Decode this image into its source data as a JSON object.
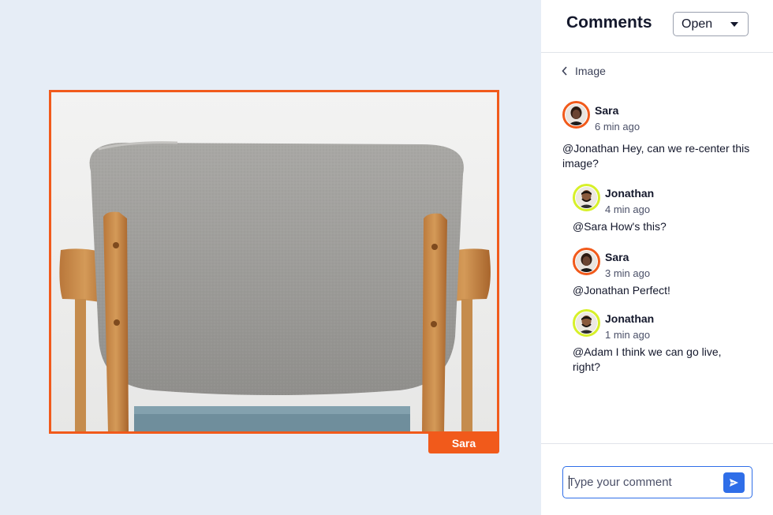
{
  "canvas": {
    "selection_user_tag": "Sara",
    "accent_color": "#f15a1b"
  },
  "panel": {
    "title": "Comments",
    "status_filter": {
      "selected": "Open"
    },
    "breadcrumb": {
      "icon": "chevron-left-icon",
      "label": "Image"
    }
  },
  "thread": [
    {
      "author": "Sara",
      "time": "6 min ago",
      "text": "@Jonathan Hey, can we re-center this image?",
      "avatar_ring": "#f15a1b"
    },
    {
      "author": "Jonathan",
      "time": "4 min ago",
      "text": "@Sara How's this?",
      "avatar_ring": "#d7f02a"
    },
    {
      "author": "Sara",
      "time": "3 min ago",
      "text": "@Jonathan Perfect!",
      "avatar_ring": "#f15a1b"
    },
    {
      "author": "Jonathan",
      "time": "1 min ago",
      "text": "@Adam I think we can go live, right?",
      "avatar_ring": "#d7f02a"
    }
  ],
  "composer": {
    "placeholder": "Type your comment",
    "send_icon": "send-icon",
    "accent_color": "#2f6ee8"
  }
}
